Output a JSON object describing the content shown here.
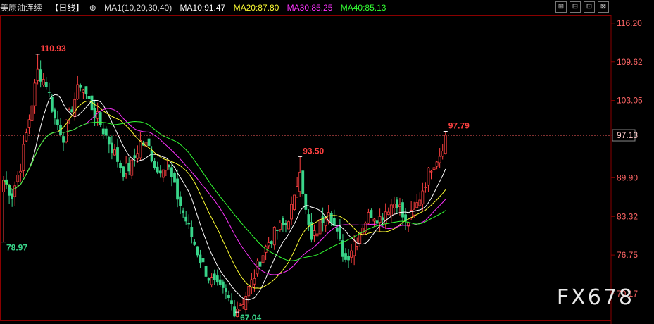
{
  "header": {
    "instrument": "美原油连续",
    "period": "【日线】",
    "ma_params": "MA1(10,20,30,40)",
    "ma10": "MA10:91.47",
    "ma20": "MA20:87.80",
    "ma30": "MA30:85.25",
    "ma40": "MA40:85.13"
  },
  "watermark": "FX678",
  "colors": {
    "up": "#ff4040",
    "down": "#39d58a",
    "grid": "#8a0000",
    "ma10": "#ffffff",
    "ma20": "#ffff33",
    "ma30": "#ff33ff",
    "ma40": "#33ff33",
    "price_line": "#ff6060"
  },
  "chart_data": {
    "type": "candlestick",
    "y_ticks": [
      "116.20",
      "109.62",
      "103.05",
      "97.13",
      "89.90",
      "83.32",
      "76.75",
      "70.17"
    ],
    "ylim": [
      65.5,
      117.5
    ],
    "last_price": 97.13,
    "annotations": [
      {
        "label": "110.93",
        "value": 110.93,
        "bar": 12
      },
      {
        "label": "78.97",
        "value": 78.97,
        "bar": 0
      },
      {
        "label": "93.50",
        "value": 93.5,
        "bar": 104
      },
      {
        "label": "67.04",
        "value": 67.04,
        "bar": 82
      },
      {
        "label": "97.79",
        "value": 97.79,
        "bar": 155
      }
    ],
    "key_points": [
      [
        0,
        89.5
      ],
      [
        3,
        87
      ],
      [
        6,
        92
      ],
      [
        9,
        100
      ],
      [
        12,
        108
      ],
      [
        15,
        106
      ],
      [
        18,
        100
      ],
      [
        21,
        97
      ],
      [
        24,
        102
      ],
      [
        27,
        106
      ],
      [
        30,
        103
      ],
      [
        33,
        100
      ],
      [
        36,
        97
      ],
      [
        39,
        94
      ],
      [
        42,
        91
      ],
      [
        45,
        92
      ],
      [
        48,
        96
      ],
      [
        51,
        95
      ],
      [
        54,
        91
      ],
      [
        57,
        93
      ],
      [
        60,
        88
      ],
      [
        63,
        84
      ],
      [
        66,
        80
      ],
      [
        69,
        76
      ],
      [
        72,
        73
      ],
      [
        75,
        71
      ],
      [
        78,
        70
      ],
      [
        81,
        67.5
      ],
      [
        84,
        69
      ],
      [
        87,
        72
      ],
      [
        90,
        76
      ],
      [
        93,
        79
      ],
      [
        96,
        81
      ],
      [
        99,
        82
      ],
      [
        102,
        86
      ],
      [
        104,
        92
      ],
      [
        106,
        84
      ],
      [
        108,
        79
      ],
      [
        111,
        82
      ],
      [
        114,
        85
      ],
      [
        117,
        80
      ],
      [
        120,
        76
      ],
      [
        123,
        79
      ],
      [
        126,
        82
      ],
      [
        129,
        84
      ],
      [
        132,
        83
      ],
      [
        135,
        85
      ],
      [
        138,
        86
      ],
      [
        141,
        82
      ],
      [
        144,
        84
      ],
      [
        147,
        88
      ],
      [
        150,
        92
      ],
      [
        153,
        94
      ],
      [
        155,
        97.1
      ]
    ]
  }
}
